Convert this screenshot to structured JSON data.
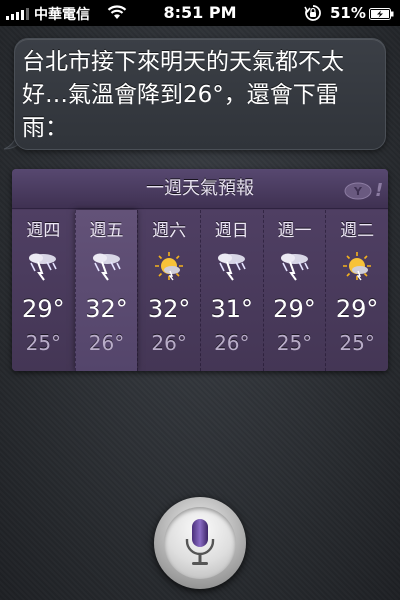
{
  "status_bar": {
    "carrier": "中華電信",
    "time": "8:51 PM",
    "battery_percent": "51%",
    "icons": [
      "signal-icon",
      "wifi-icon",
      "rotation-lock-icon",
      "battery-charging-icon"
    ]
  },
  "siri_response": {
    "text": "台北市接下來明天的天氣都不太好…氣溫會降到26°，還會下雷雨："
  },
  "weather": {
    "title": "一週天氣預報",
    "provider_icon": "yahoo-logo",
    "days": [
      {
        "label": "週四",
        "condition": "thunderstorm",
        "high": "29°",
        "low": "25°"
      },
      {
        "label": "週五",
        "condition": "thunderstorm",
        "high": "32°",
        "low": "26°"
      },
      {
        "label": "週六",
        "condition": "sunny-thunderstorm",
        "high": "32°",
        "low": "26°"
      },
      {
        "label": "週日",
        "condition": "thunderstorm",
        "high": "31°",
        "low": "26°"
      },
      {
        "label": "週一",
        "condition": "thunderstorm",
        "high": "29°",
        "low": "25°"
      },
      {
        "label": "週二",
        "condition": "sunny-thunderstorm",
        "high": "29°",
        "low": "25°"
      }
    ]
  },
  "colors": {
    "card_bg": "#4a3a5c",
    "header_bg": "#574870",
    "low_temp": "#b9adc9",
    "mic_accent": "#6a4a9c"
  },
  "mic_button": {
    "icon": "microphone-icon"
  }
}
